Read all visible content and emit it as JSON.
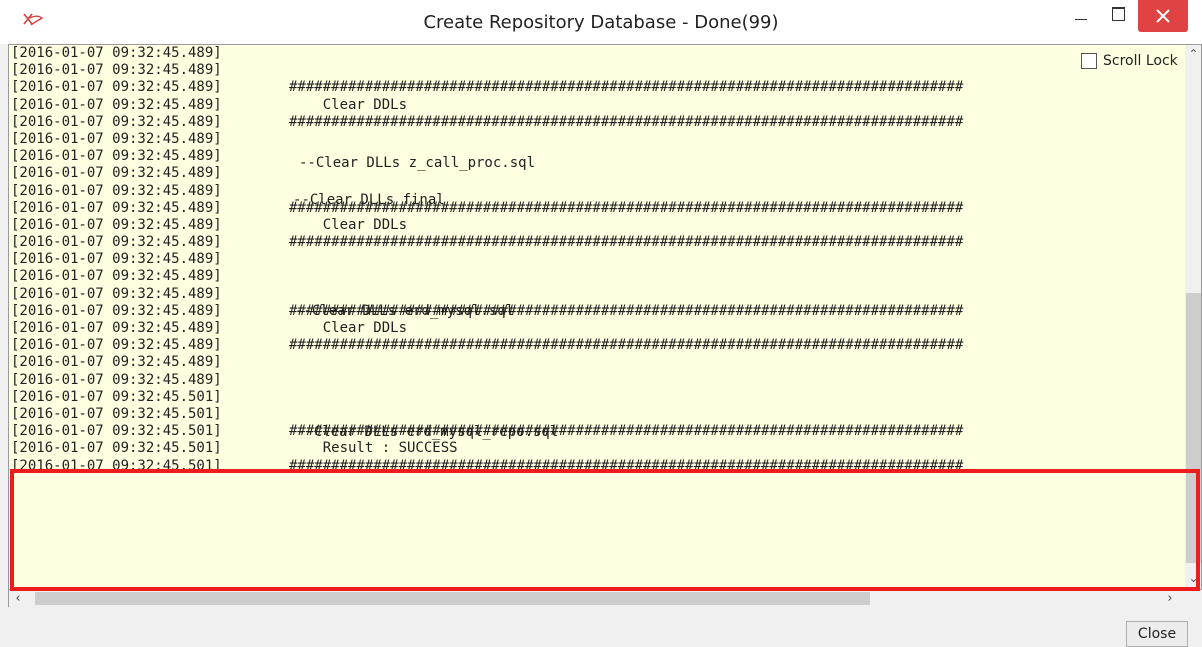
{
  "window": {
    "title": "Create Repository Database - Done(99)",
    "icon": "app-logo-icon"
  },
  "scroll_lock": {
    "label": "Scroll Lock",
    "checked": false
  },
  "log": [
    {
      "ts": "[2016-01-07 09:32:45.489]",
      "msg": ""
    },
    {
      "ts": "[2016-01-07 09:32:45.489]",
      "msg": ""
    },
    {
      "ts": "[2016-01-07 09:32:45.489]",
      "msg": "################################################################################"
    },
    {
      "ts": "[2016-01-07 09:32:45.489]",
      "msg": "    Clear DDLs"
    },
    {
      "ts": "[2016-01-07 09:32:45.489]",
      "msg": "################################################################################"
    },
    {
      "ts": "[2016-01-07 09:32:45.489]",
      "msg": ""
    },
    {
      "ts": "[2016-01-07 09:32:45.489]",
      "msg": ""
    },
    {
      "ts": "[2016-01-07 09:32:45.489]",
      "msg": ""
    },
    {
      "ts": "[2016-01-07 09:32:45.489]",
      "msg": ""
    },
    {
      "ts": "[2016-01-07 09:32:45.489]",
      "msg": "################################################################################"
    },
    {
      "ts": "[2016-01-07 09:32:45.489]",
      "msg": "    Clear DDLs"
    },
    {
      "ts": "[2016-01-07 09:32:45.489]",
      "msg": "################################################################################"
    },
    {
      "ts": "[2016-01-07 09:32:45.489]",
      "msg": ""
    },
    {
      "ts": "[2016-01-07 09:32:45.489]",
      "msg": ""
    },
    {
      "ts": "[2016-01-07 09:32:45.489]",
      "msg": ""
    },
    {
      "ts": "[2016-01-07 09:32:45.489]",
      "msg": "################################################################################"
    },
    {
      "ts": "[2016-01-07 09:32:45.489]",
      "msg": "    Clear DDLs"
    },
    {
      "ts": "[2016-01-07 09:32:45.489]",
      "msg": "################################################################################"
    },
    {
      "ts": "[2016-01-07 09:32:45.489]",
      "msg": ""
    },
    {
      "ts": "[2016-01-07 09:32:45.489]",
      "msg": ""
    },
    {
      "ts": "[2016-01-07 09:32:45.501]",
      "msg": ""
    },
    {
      "ts": "[2016-01-07 09:32:45.501]",
      "msg": ""
    },
    {
      "ts": "[2016-01-07 09:32:45.501]",
      "msg": "################################################################################"
    },
    {
      "ts": "[2016-01-07 09:32:45.501]",
      "msg": "    Result : SUCCESS"
    },
    {
      "ts": "[2016-01-07 09:32:45.501]",
      "msg": "################################################################################"
    }
  ],
  "floating_lines": [
    "--Clear DLLs z_call_proc.sql",
    "--Clear DLLs final",
    "--Clear DLLs erd_mysql.sql",
    "--Clear DLLs erd_mysql_repo.sql"
  ],
  "buttons": {
    "close_label": "Close"
  },
  "colors": {
    "log_background": "#ffffe1",
    "highlight": "#ee1c1c",
    "close_button": "#e04343"
  }
}
